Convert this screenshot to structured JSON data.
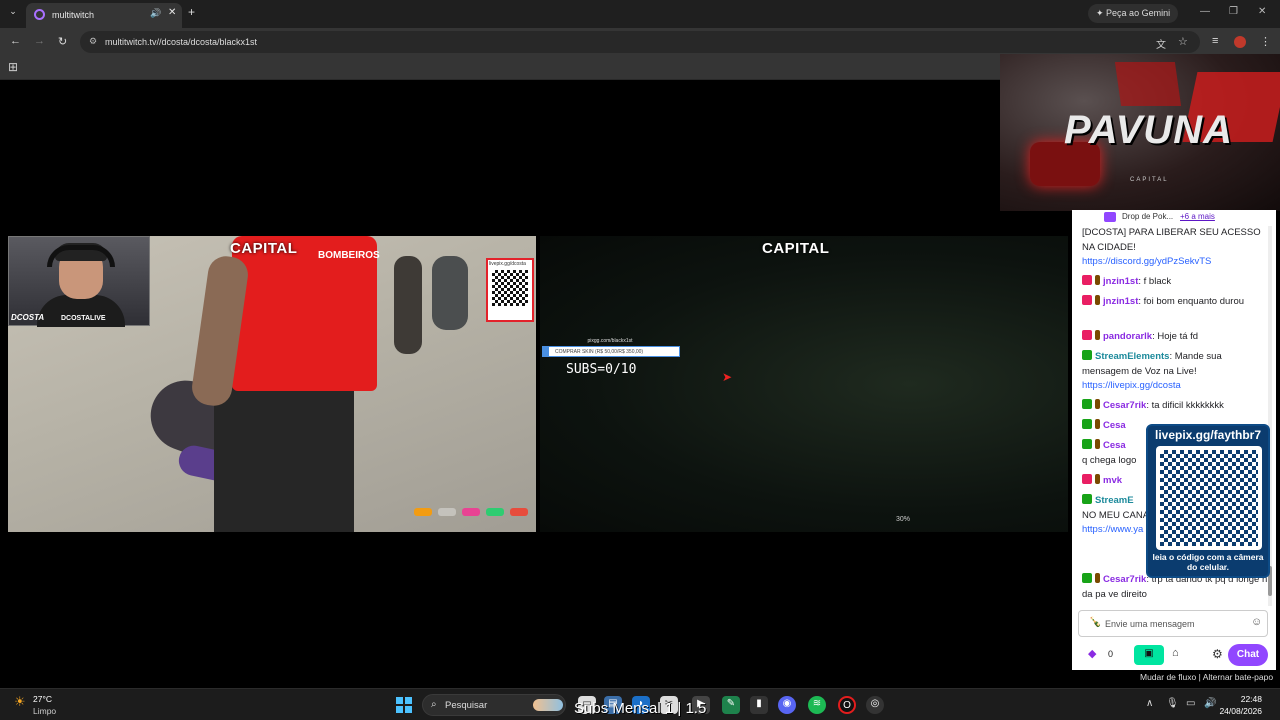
{
  "browser": {
    "tab_title": "multitwitch",
    "gemini_label": "Peça ao Gemini",
    "url": "multitwitch.tv//dcosta/dcosta/blackx1st"
  },
  "stream1": {
    "webcam_name": "DCOSTA",
    "webcam_handle": "DCOSTALIVE",
    "logo": "CAPITAL",
    "bombeiros": "BOMBEIROS",
    "qr_url": "livepix.gg/dcosta"
  },
  "stream2": {
    "logo": "CAPITAL",
    "donate_url": "pixgg.com/blackx1st",
    "donate_label": "COMPRAR SKIN (R$ 50,00/R$ 350,00)",
    "subs_counter": "SUBS=0/10",
    "hud_text": "30%"
  },
  "promo": {
    "title": "PAVUNA",
    "subtitle": "CAPITAL"
  },
  "chat": {
    "pinned_drop": "Drop de Pok...",
    "pinned_more": "+6 a mais",
    "messages": [
      {
        "user": "",
        "text": "[DCOSTA] PARA LIBERAR SEU ACESSO NA CIDADE!",
        "link": "https://discord.gg/ydPzSekvTS"
      },
      {
        "user": "jnzin1st",
        "text": "f black"
      },
      {
        "user": "jnzin1st",
        "text": "foi bom enquanto durou"
      },
      {
        "user": "pandorarlk",
        "text": "Hoje tá fd"
      },
      {
        "user": "StreamElements",
        "text": "Mande sua mensagem de Voz na Live!",
        "link": "https://livepix.gg/dcosta"
      },
      {
        "user": "Cesar7rik",
        "text": "ta dificil kkkkkkkk"
      },
      {
        "user": "Cesa",
        "text": ""
      },
      {
        "user": "Cesa",
        "text": "q chega logo"
      },
      {
        "user": "mvk",
        "text": ""
      },
      {
        "user": "StreamE",
        "text": "NO MEU CANA CORTES:",
        "link": "https://www.ya costaa/videos"
      },
      {
        "user": "Cesar7rik",
        "text": "trp ta dando tk pq d longe n da pa ve direito"
      }
    ],
    "input_placeholder": "Envie uma mensagem",
    "points": "0",
    "chat_button": "Chat",
    "qr_title": "livepix.gg/faythbr7",
    "qr_caption": "leia o código com a câmera do celular.",
    "footer": "Mudar de fluxo | Alternar bate-papo"
  },
  "taskbar": {
    "temperature": "27°C",
    "weather": "Limpo",
    "search_label": "Pesquisar",
    "overlay_text": "Subs Mensal 1 | 1.5",
    "time": "22:48",
    "date": "24/08/2026"
  },
  "colors": {
    "twitch_purple": "#9147ff",
    "capital_red": "#e31d1d",
    "qr_blue": "#0b3c6f"
  }
}
